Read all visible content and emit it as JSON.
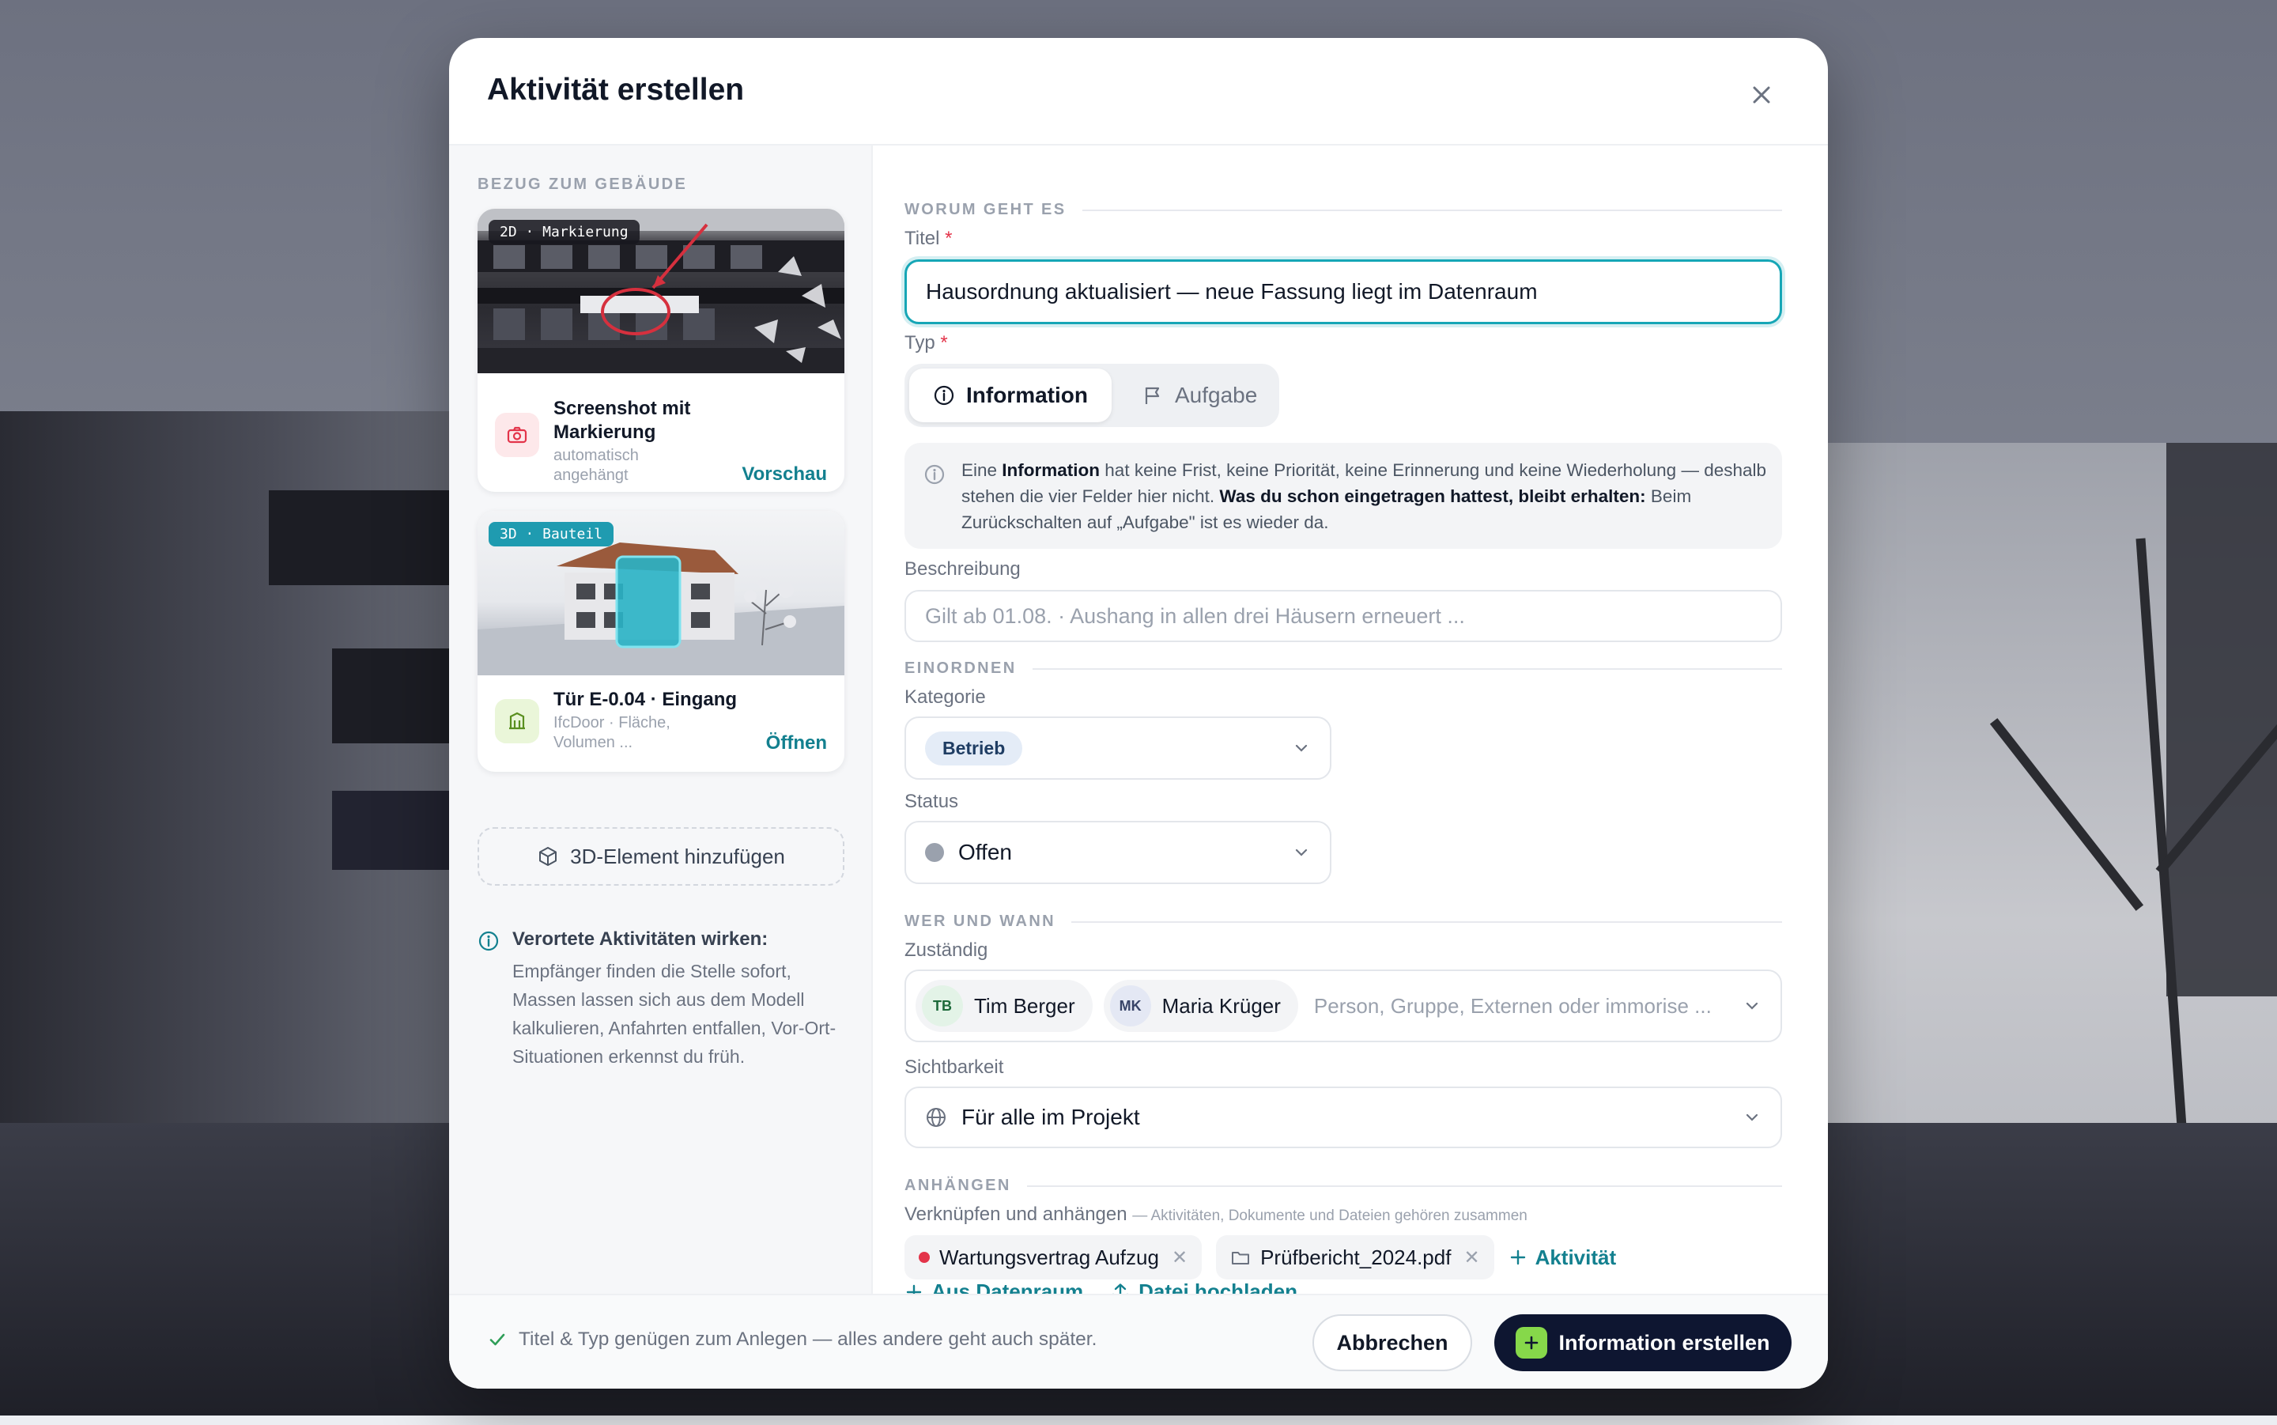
{
  "modal": {
    "title": "Aktivität erstellen"
  },
  "left": {
    "section_label": "BEZUG ZUM GEBÄUDE",
    "cards": [
      {
        "tag": "2D · Markierung",
        "title": "Screenshot mit Markierung",
        "subtitle": "automatisch angehängt",
        "link": "Vorschau",
        "icon": "camera-icon"
      },
      {
        "tag": "3D · Bauteil",
        "title": "Tür E-0.04 · Eingang",
        "subtitle": "IfcDoor · Fläche, Volumen ...",
        "link": "Öffnen",
        "icon": "building-icon"
      }
    ],
    "add_3d_label": "3D-Element hinzufügen",
    "hint_title": "Verortete Aktivitäten wirken:",
    "hint_body": "Empfänger finden die Stelle sofort, Massen lassen sich aus dem Modell kalkulieren, Anfahrten entfallen, Vor-Ort-Situationen erkennst du früh."
  },
  "form": {
    "section_what": "WORUM GEHT ES",
    "title_label": "Titel",
    "title_value": "Hausordnung aktualisiert — neue Fassung liegt im Datenraum",
    "type_label": "Typ",
    "type_options": [
      "Information",
      "Aufgabe"
    ],
    "type_selected": "Information",
    "info_pre": "Eine ",
    "info_bold1": "Information",
    "info_mid": " hat keine Frist, keine Priorität, keine Erinnerung und keine Wiederholung — deshalb stehen die vier Felder hier nicht. ",
    "info_bold2": "Was du schon eingetragen hattest, bleibt erhalten:",
    "info_post": " Beim Zurückschalten auf „Aufgabe\" ist es wieder da.",
    "description_label": "Beschreibung",
    "description_placeholder": "Gilt ab 01.08. · Aushang in allen drei Häusern erneuert ...",
    "section_classify": "EINORDNEN",
    "category_label": "Kategorie",
    "category_value": "Betrieb",
    "status_label": "Status",
    "status_value": "Offen",
    "section_who": "WER UND WANN",
    "assignee_label": "Zuständig",
    "assignees": [
      {
        "initials": "TB",
        "name": "Tim Berger"
      },
      {
        "initials": "MK",
        "name": "Maria Krüger"
      }
    ],
    "assignee_placeholder": "Person, Gruppe, Externen oder immorise ...",
    "visibility_label": "Sichtbarkeit",
    "visibility_value": "Für alle im Projekt",
    "section_attach": "ANHÄNGEN",
    "attach_label": "Verknüpfen und anhängen",
    "attach_sub": "— Aktivitäten, Dokumente und Dateien gehören zusammen",
    "attachments": [
      {
        "name": "Wartungsvertrag Aufzug",
        "kind": "activity"
      },
      {
        "name": "Prüfbericht_2024.pdf",
        "kind": "file"
      }
    ],
    "add_activity": "Aktivität",
    "from_dataroom": "Aus Datenraum",
    "upload_file": "Datei hochladen"
  },
  "footer": {
    "hint": "Titel & Typ genügen zum Anlegen — alles andere geht auch später.",
    "cancel": "Abbrechen",
    "submit": "Information erstellen"
  },
  "colors": {
    "accent": "#13808f",
    "primary_button": "#0e1631",
    "required": "#e3344a"
  }
}
